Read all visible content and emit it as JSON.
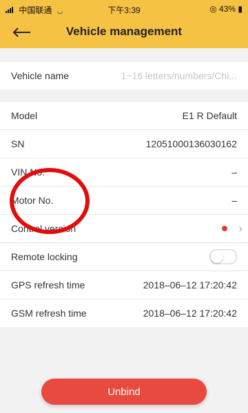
{
  "status_bar": {
    "carrier": "中国联通",
    "time": "下午3:39",
    "battery": "43%"
  },
  "header": {
    "title": "Vehicle management"
  },
  "vehicle_name": {
    "label": "Vehicle name",
    "placeholder": "1~16 letters/numbers/Chi..."
  },
  "details": [
    {
      "label": "Model",
      "value": "E1 R Default"
    },
    {
      "label": "SN",
      "value": "12051000136030162"
    },
    {
      "label": "VIN No.",
      "value": "–"
    },
    {
      "label": "Motor No.",
      "value": "–"
    },
    {
      "label": "Control version",
      "value": ""
    },
    {
      "label": "Remote locking",
      "value": ""
    },
    {
      "label": "GPS refresh time",
      "value": "2018–06–12 17:20:42"
    },
    {
      "label": "GSM refresh time",
      "value": "2018–06–12 17:20:42"
    }
  ],
  "buttons": {
    "unbind": "Unbind"
  },
  "colors": {
    "header": "#f6c243",
    "accent_red": "#e84a3f"
  }
}
